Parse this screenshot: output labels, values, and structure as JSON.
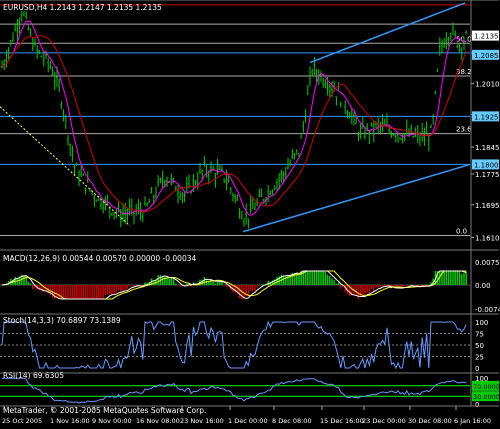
{
  "main": {
    "header": "EURUSD,H4  1.2143  1.2147  1.2135  1.2135",
    "price_ticks": [
      "1.2135",
      "1.2090",
      "1.2010",
      "1.1930",
      "1.1845",
      "1.1775",
      "1.1695",
      "1.1610"
    ],
    "boxed_prices": [
      {
        "label": "1.2135",
        "price": 1.2135,
        "bg": "#ffffff",
        "fg": "#000000"
      },
      {
        "label": "1.2085",
        "price": 1.2085,
        "bg": "#66ccff",
        "fg": "#000000"
      },
      {
        "label": "1.1925",
        "price": 1.1925,
        "bg": "#66ccff",
        "fg": "#000000"
      },
      {
        "label": "1.1800",
        "price": 1.18,
        "bg": "#66ccff",
        "fg": "#000000"
      }
    ],
    "fib_labels": [
      {
        "label": "50.0",
        "price": 1.2115
      },
      {
        "label": "38.2",
        "price": 1.203
      },
      {
        "label": "23.6",
        "price": 1.188
      },
      {
        "label": "0.0",
        "price": 1.1615
      }
    ],
    "price_range": [
      1.158,
      1.2225
    ]
  },
  "macd": {
    "header": "MACD(12,26,9) 0.00544 0.00570 0.00000 -0.00034",
    "ticks": [
      "0.00757",
      "0.00",
      "-0.00745"
    ]
  },
  "stoch": {
    "header": "Stoch(14,3,3) 70.6897 73.1389",
    "ticks": [
      "100",
      "75",
      "50",
      "25",
      "0"
    ]
  },
  "rsi": {
    "header": "RSI(14) 69.6305",
    "ticks": [
      "100",
      "70.0000",
      "30.0000",
      "0"
    ]
  },
  "copyright": "MetaTrader, © 2001-2005 MetaQuotes Software Corp.",
  "time_axis": [
    "25 Oct 2005",
    "1 Nov 16:00",
    "9 Nov 00:00",
    "16 Nov 08:00",
    "23 Nov 16:00",
    "1 Dec 00:00",
    "8 Dec 08:00",
    "15 Dec 16:00",
    "23 Dec 00:00",
    "30 Dec 08:00",
    "6 Jan 16:00"
  ],
  "colors": {
    "background": "#000000",
    "candles": "#00cc00",
    "ma_fast": "#ff00ff",
    "ma_slow": "#cc0000",
    "channel": "#3399ff",
    "fib": "#aaaaaa",
    "macd_pos": "#00cc00",
    "macd_neg": "#cc0000",
    "signal": "#ffff00",
    "stoch_main": "#6699ff",
    "rsi_line": "#6699ff",
    "rsi_levels": "#00ff00",
    "axis_text": "#ffffff"
  }
}
